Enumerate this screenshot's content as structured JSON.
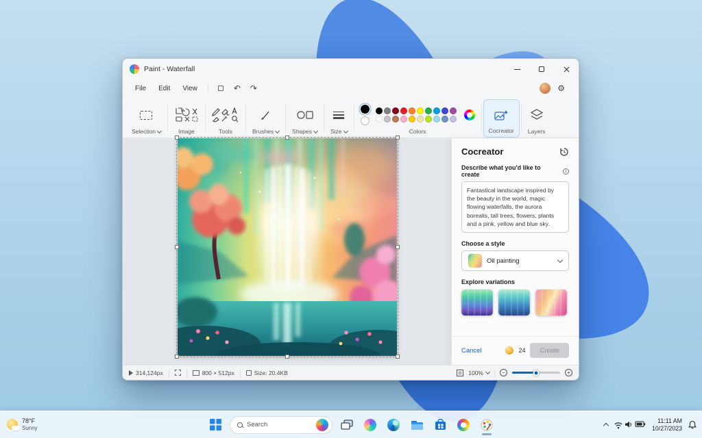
{
  "window": {
    "title": "Paint - Waterfall",
    "menu": [
      "File",
      "Edit",
      "View"
    ],
    "ribbon": {
      "groups": [
        "Selection",
        "Image",
        "Tools",
        "Brushes",
        "Shapes",
        "Size",
        "Colors",
        "Cocreator",
        "Layers"
      ],
      "colors_row1": [
        "#000000",
        "#7f7f7f",
        "#880015",
        "#ed1c24",
        "#ff7f27",
        "#fff200",
        "#22b14c",
        "#00a2e8",
        "#3f48cc",
        "#a349a4"
      ],
      "colors_row2": [
        "#ffffff",
        "#c3c3c3",
        "#b97a57",
        "#ffaec9",
        "#ffc90e",
        "#efe4b0",
        "#b5e61d",
        "#99d9ea",
        "#7092be",
        "#c8bfe7"
      ]
    },
    "cocreator": {
      "title": "Cocreator",
      "describe_label": "Describe what you'd like to create",
      "prompt": "Fantastical landscape inspired by the beauty in the world, magic flowing waterfalls, the aurora borealis, tall trees, flowers, plants and a pink, yellow and blue sky.",
      "style_label": "Choose a style",
      "style_value": "Oil painting",
      "variations_label": "Explore variations",
      "cancel_label": "Cancel",
      "credits": "24",
      "create_label": "Create"
    },
    "statusbar": {
      "cursor": "314,124px",
      "dimensions": "800 × 512px",
      "file_size": "Size: 20.4KB",
      "zoom": "100%"
    }
  },
  "taskbar": {
    "weather_temp": "78°F",
    "weather_condition": "Sunny",
    "search_text": "Search",
    "time": "11:11 AM",
    "date": "10/27/2023"
  },
  "icons": {
    "gear": "⚙",
    "undo": "↶",
    "redo": "↷",
    "info": "i",
    "zoom_out": "−",
    "zoom_in": "+"
  },
  "accent": "#0067c0"
}
